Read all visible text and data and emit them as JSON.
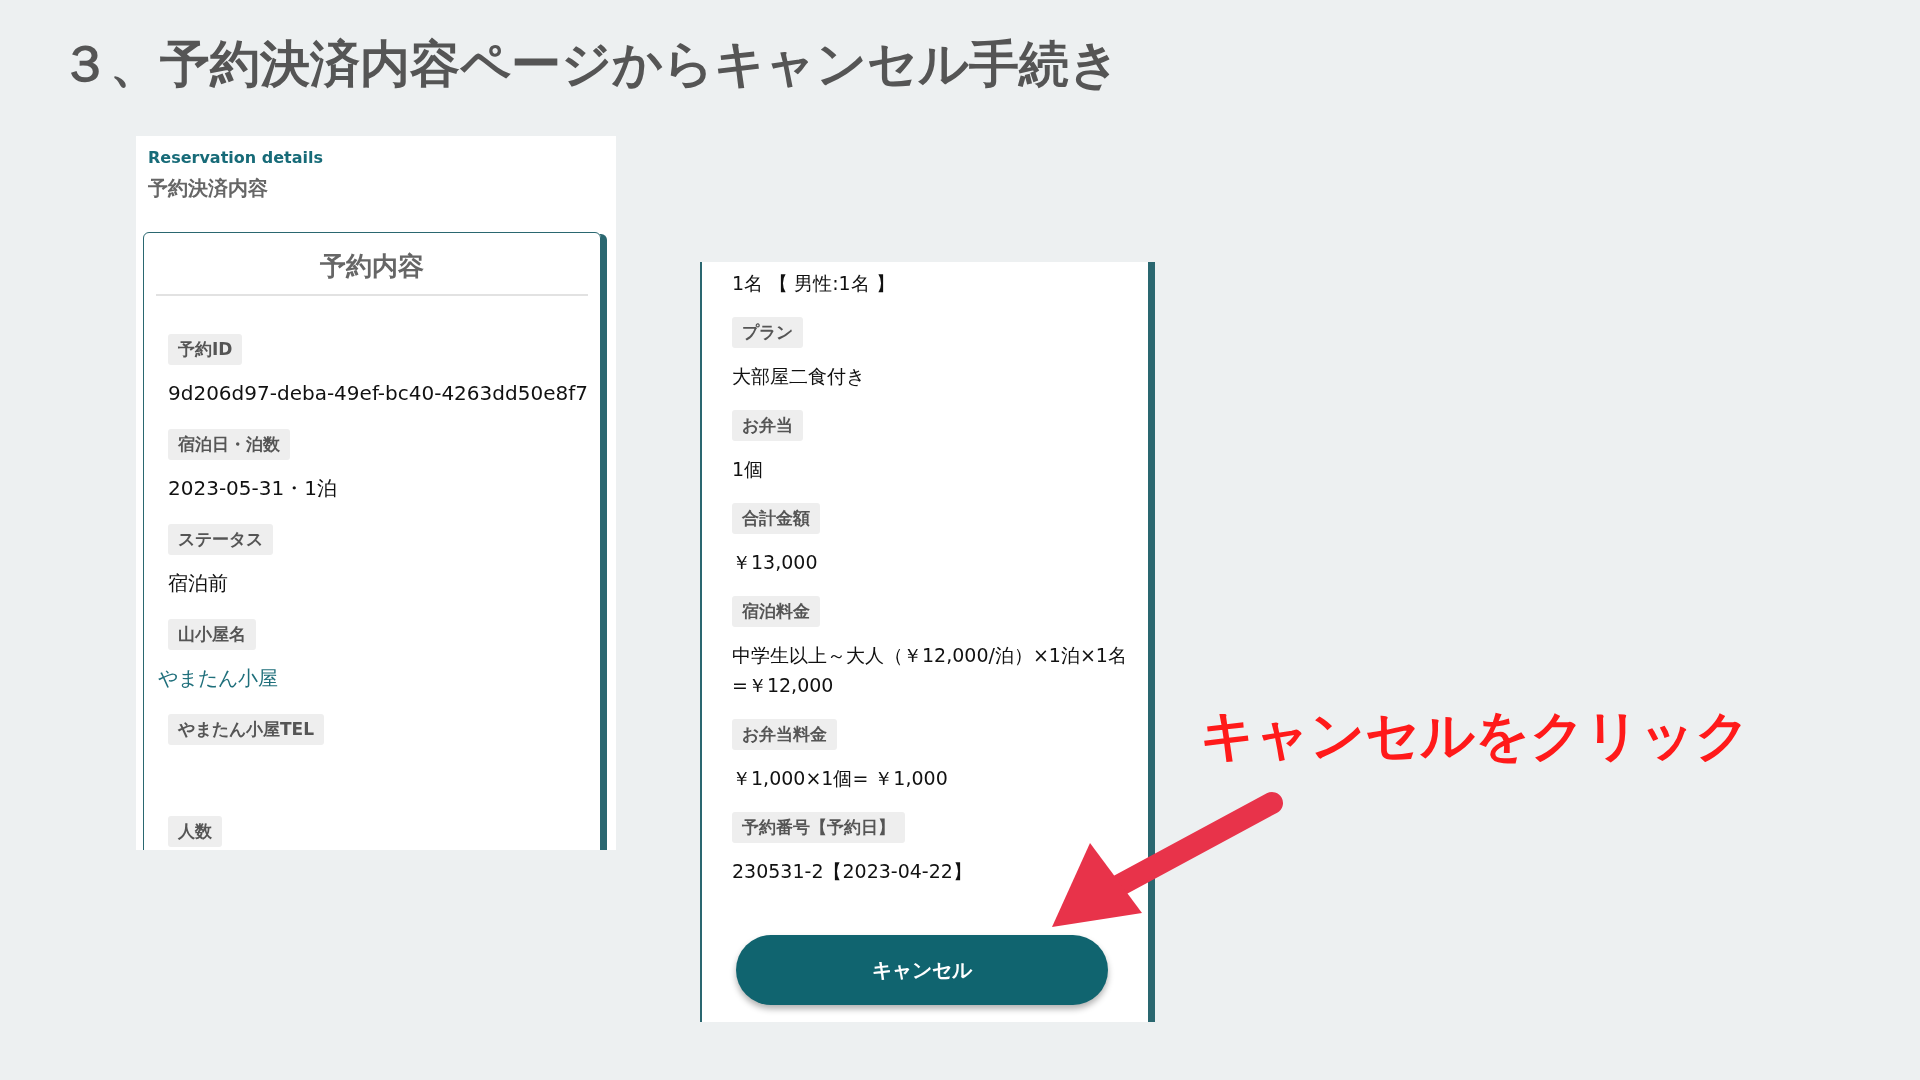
{
  "title": "３、予約決済内容ページからキャンセル手続き",
  "left_panel": {
    "eyebrow": "Reservation details",
    "heading": "予約決済内容",
    "card_title": "予約内容",
    "fields": [
      {
        "label": "予約ID",
        "kind": "text",
        "value": "9d206d97-deba-49ef-bc40-4263dd50e8f7"
      },
      {
        "label": "宿泊日・泊数",
        "kind": "text",
        "value": "2023-05-31・1泊"
      },
      {
        "label": "ステータス",
        "kind": "text",
        "value": "宿泊前"
      },
      {
        "label": "山小屋名",
        "kind": "link",
        "value": "やまたん小屋"
      },
      {
        "label": "やまたん小屋TEL",
        "kind": "empty"
      },
      {
        "label": "人数",
        "kind": "cut"
      }
    ]
  },
  "right_panel": {
    "leading_value": "1名 【 男性:1名 】",
    "fields": [
      {
        "label": "プラン",
        "kind": "text",
        "value": "大部屋二食付き"
      },
      {
        "label": "お弁当",
        "kind": "text",
        "value": "1個"
      },
      {
        "label": "合計金額",
        "kind": "text",
        "value": "￥13,000"
      },
      {
        "label": "宿泊料金",
        "kind": "text",
        "value": "中学生以上～大人（￥12,000/泊）×1泊×1名\n=￥12,000"
      },
      {
        "label": "お弁当料金",
        "kind": "text",
        "value": "￥1,000×1個= ￥1,000"
      },
      {
        "label": "予約番号【予約日】",
        "kind": "text",
        "value": "230531-2【2023-04-22】"
      }
    ],
    "button": "キャンセル"
  },
  "annotation": "キャンセルをクリック"
}
